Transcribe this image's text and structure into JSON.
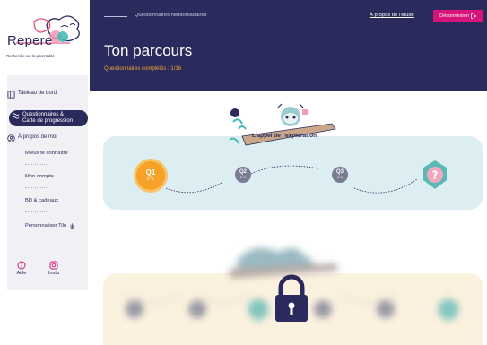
{
  "brand": {
    "name": "Repere",
    "tagline": "Recherche sur la parentalité"
  },
  "sidebar": {
    "items": [
      {
        "label": "Tableau de bord",
        "icon": "dashboard-icon"
      },
      {
        "label": "Questionnaires &",
        "label2": "Carte de progression",
        "icon": "map-icon",
        "active": true
      },
      {
        "label": "À propos de moi",
        "icon": "user-circle-icon"
      }
    ],
    "subitems": [
      {
        "label": "Mieux te connaître"
      },
      {
        "label": "Mon compte"
      },
      {
        "label": "BD & cadeaux"
      },
      {
        "label": "Personnaliser Tilo"
      }
    ],
    "footer": [
      {
        "label": "Aide",
        "icon": "help-icon"
      },
      {
        "label": "Insta",
        "icon": "instagram-icon"
      }
    ]
  },
  "header": {
    "breadcrumb": "Questionnaires hebdomadaires",
    "about_link": "À propos de l'étude",
    "logout_label": "Déconnexion",
    "title": "Ton parcours",
    "progress": "Questionnaires complétés : 1/16"
  },
  "chapter": {
    "title": "L'appel de l'exploration",
    "nodes": [
      {
        "label": "Q1",
        "pct": "0 %"
      },
      {
        "label": "Q2",
        "pct": "0 %"
      },
      {
        "label": "Q3",
        "pct": "0 %"
      }
    ],
    "mystery": "?"
  },
  "colors": {
    "navy": "#2b2a5c",
    "magenta": "#d6147a",
    "orange": "#f6a128",
    "band_blue": "#dceef1",
    "band_beige": "#fbf1df",
    "teal": "#5cb8b4"
  }
}
